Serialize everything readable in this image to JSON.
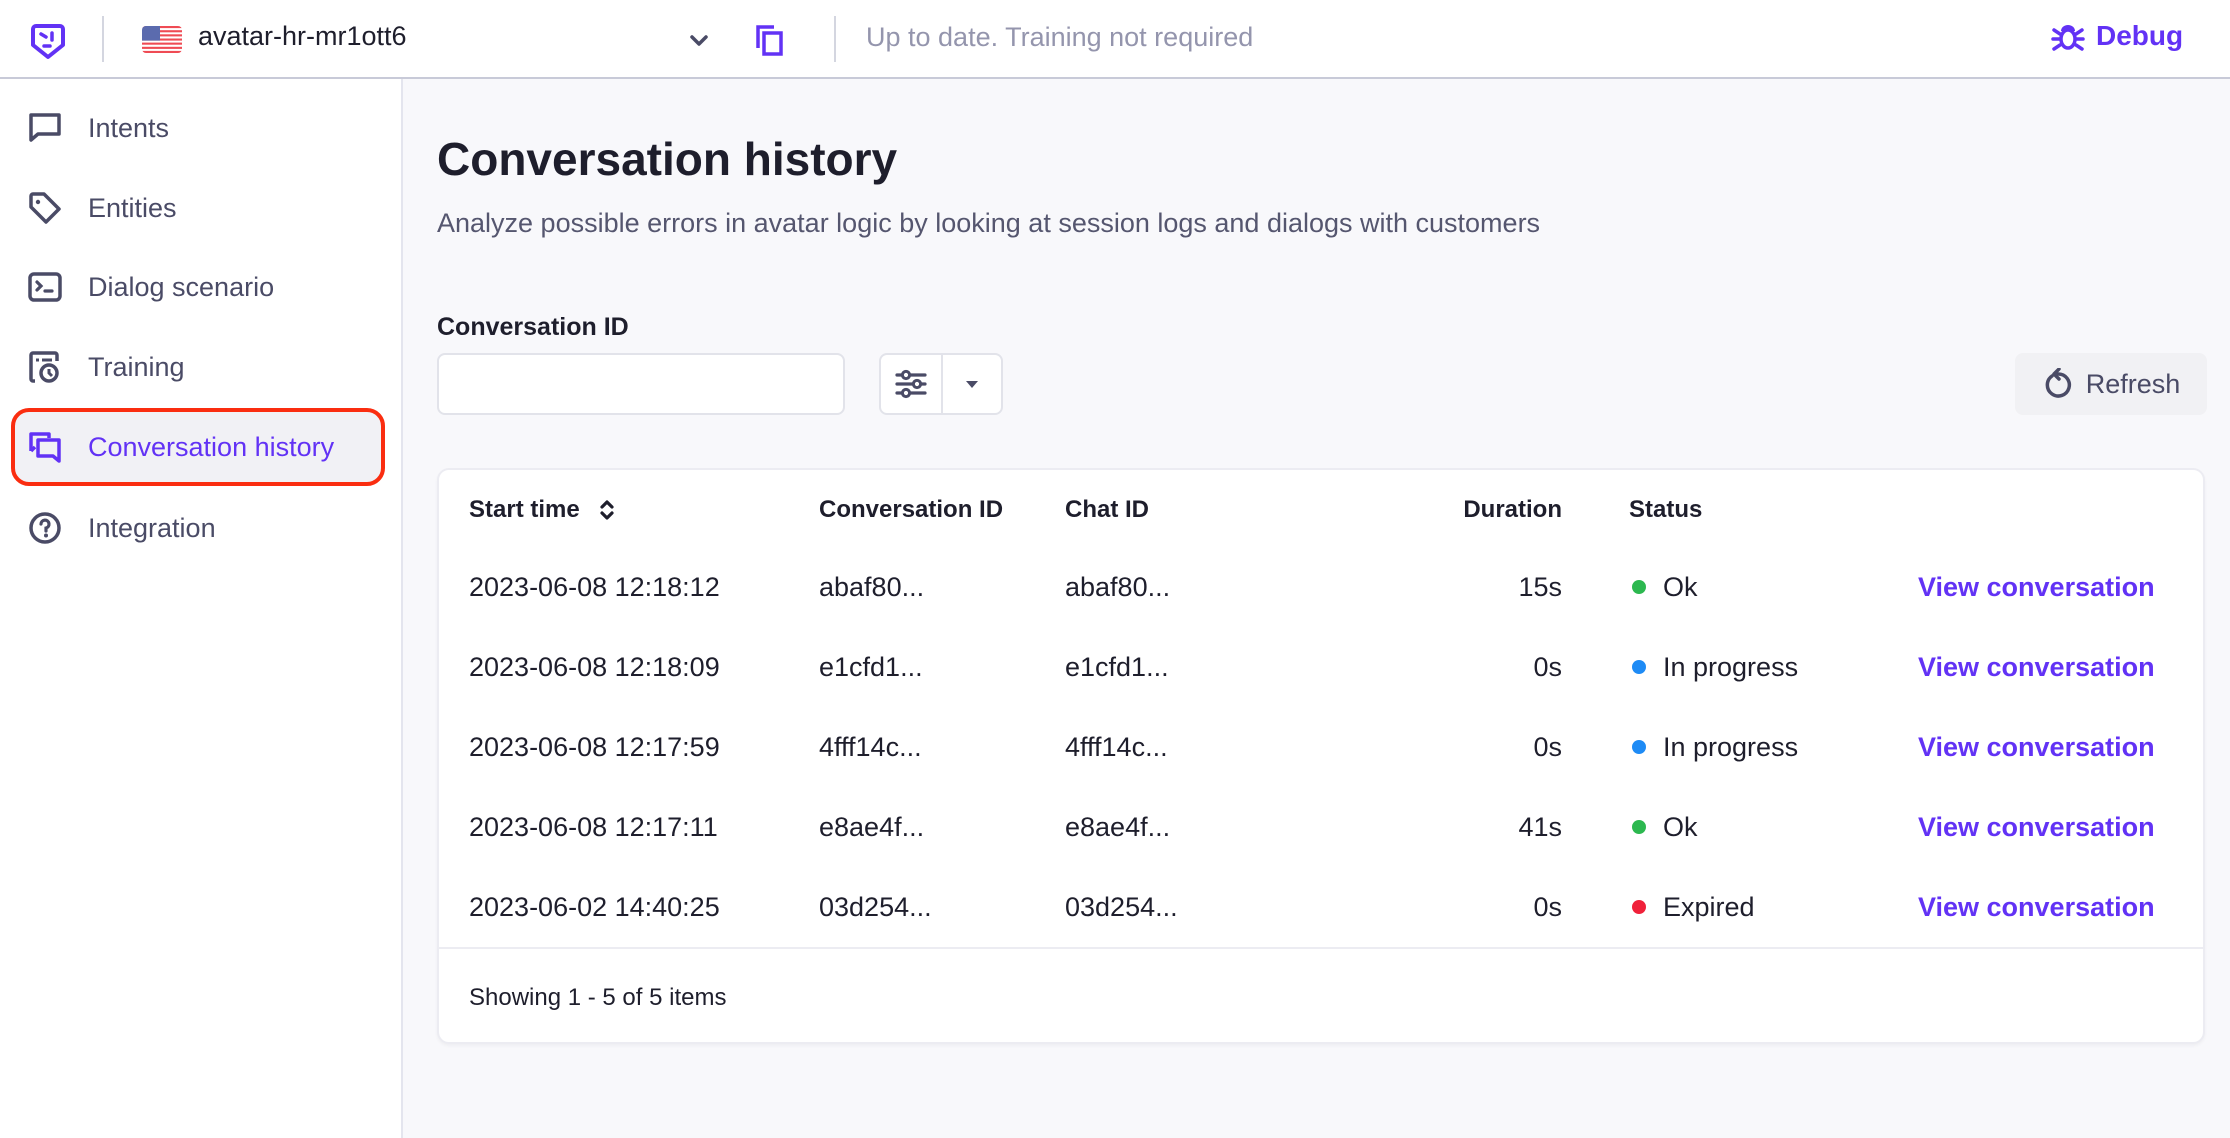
{
  "topbar": {
    "avatar_name": "avatar-hr-mr1ott6",
    "training_status": "Up to date. Training not required",
    "debug_label": "Debug"
  },
  "sidebar": {
    "items": [
      {
        "label": "Intents",
        "icon": "chat-bubble-icon",
        "active": false
      },
      {
        "label": "Entities",
        "icon": "tag-icon",
        "active": false
      },
      {
        "label": "Dialog scenario",
        "icon": "terminal-icon",
        "active": false
      },
      {
        "label": "Training",
        "icon": "training-clock-icon",
        "active": false
      },
      {
        "label": "Conversation history",
        "icon": "conversations-icon",
        "active": true
      },
      {
        "label": "Integration",
        "icon": "question-circle-icon",
        "active": false
      }
    ]
  },
  "main": {
    "title": "Conversation history",
    "subtitle": "Analyze possible errors in avatar logic by looking at session logs and dialogs with customers",
    "filter": {
      "label": "Conversation ID",
      "value": "",
      "placeholder": ""
    },
    "refresh_label": "Refresh",
    "table": {
      "columns": [
        "Start time",
        "Conversation ID",
        "Chat ID",
        "Duration",
        "Status"
      ],
      "rows": [
        {
          "start_time": "2023-06-08 12:18:12",
          "conversation_id": "abaf80...",
          "chat_id": "abaf80...",
          "duration": "15s",
          "status": "Ok",
          "status_color": "#2cb84f",
          "action": "View conversation"
        },
        {
          "start_time": "2023-06-08 12:18:09",
          "conversation_id": "e1cfd1...",
          "chat_id": "e1cfd1...",
          "duration": "0s",
          "status": "In progress",
          "status_color": "#1e8bf5",
          "action": "View conversation"
        },
        {
          "start_time": "2023-06-08 12:17:59",
          "conversation_id": "4fff14c...",
          "chat_id": "4fff14c...",
          "duration": "0s",
          "status": "In progress",
          "status_color": "#1e8bf5",
          "action": "View conversation"
        },
        {
          "start_time": "2023-06-08 12:17:11",
          "conversation_id": "e8ae4f...",
          "chat_id": "e8ae4f...",
          "duration": "41s",
          "status": "Ok",
          "status_color": "#2cb84f",
          "action": "View conversation"
        },
        {
          "start_time": "2023-06-02 14:40:25",
          "conversation_id": "03d254...",
          "chat_id": "03d254...",
          "duration": "0s",
          "status": "Expired",
          "status_color": "#f0213a",
          "action": "View conversation"
        }
      ],
      "footer": "Showing 1 - 5 of 5 items"
    }
  },
  "colors": {
    "accent": "#6232f5",
    "highlight_outline": "#fa2d10"
  }
}
